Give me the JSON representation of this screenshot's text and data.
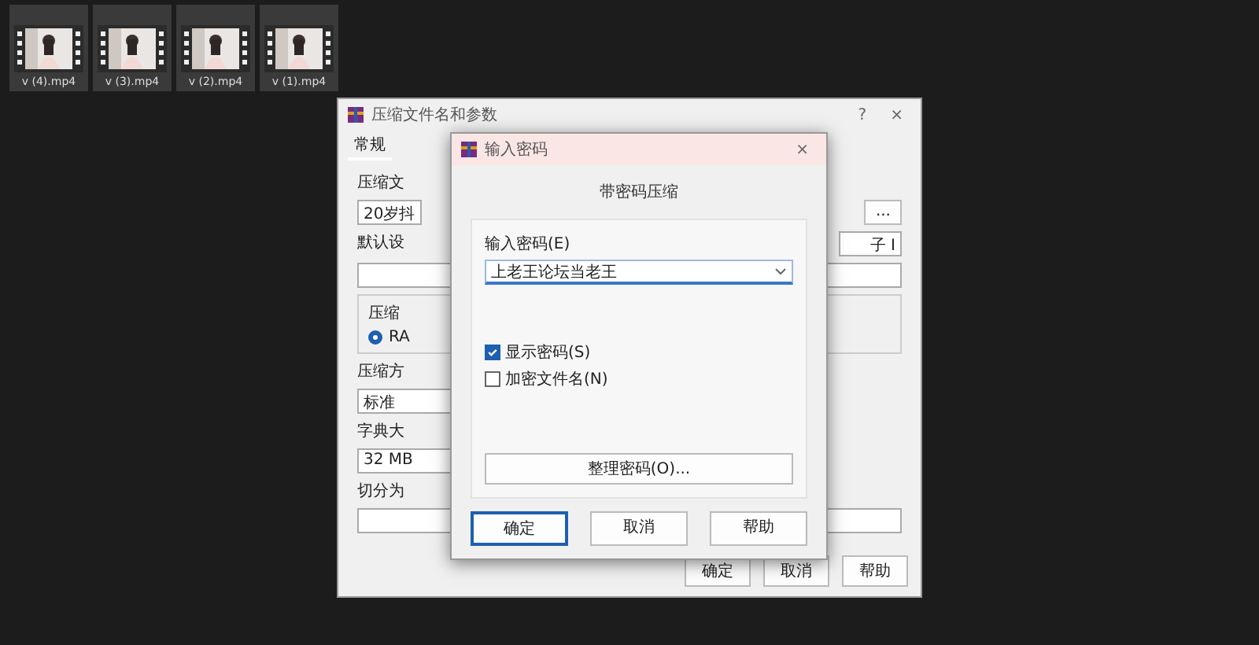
{
  "files": [
    {
      "name": "v (4).mp4"
    },
    {
      "name": "v (3).mp4"
    },
    {
      "name": "v (2).mp4"
    },
    {
      "name": "v (1).mp4"
    }
  ],
  "archive_dialog": {
    "title": "压缩文件名和参数",
    "help": "?",
    "close": "×",
    "tab": "常规",
    "name_label": "压缩文",
    "name_value": "20岁抖",
    "browse": "...",
    "profile_label": "默认设",
    "format_group": "压缩",
    "format_option": "RA",
    "format_selected": true,
    "method_label": "压缩方",
    "method_value": "标准",
    "dict_label": "字典大",
    "dict_value": "32 MB",
    "split_label": "切分为",
    "side_value": "子 I",
    "buttons": [
      "确定",
      "取消",
      "帮助"
    ]
  },
  "password_dialog": {
    "title": "输入密码",
    "close": "×",
    "heading": "带密码压缩",
    "field_label": "输入密码(E)",
    "value": "上老王论坛当老王",
    "options": [
      {
        "label": "显示密码(S)",
        "checked": true
      },
      {
        "label": "加密文件名(N)",
        "checked": false
      }
    ],
    "organize": "整理密码(O)...",
    "buttons": [
      {
        "label": "确定",
        "selected": true
      },
      {
        "label": "取消",
        "selected": false
      },
      {
        "label": "帮助",
        "selected": false
      }
    ]
  }
}
